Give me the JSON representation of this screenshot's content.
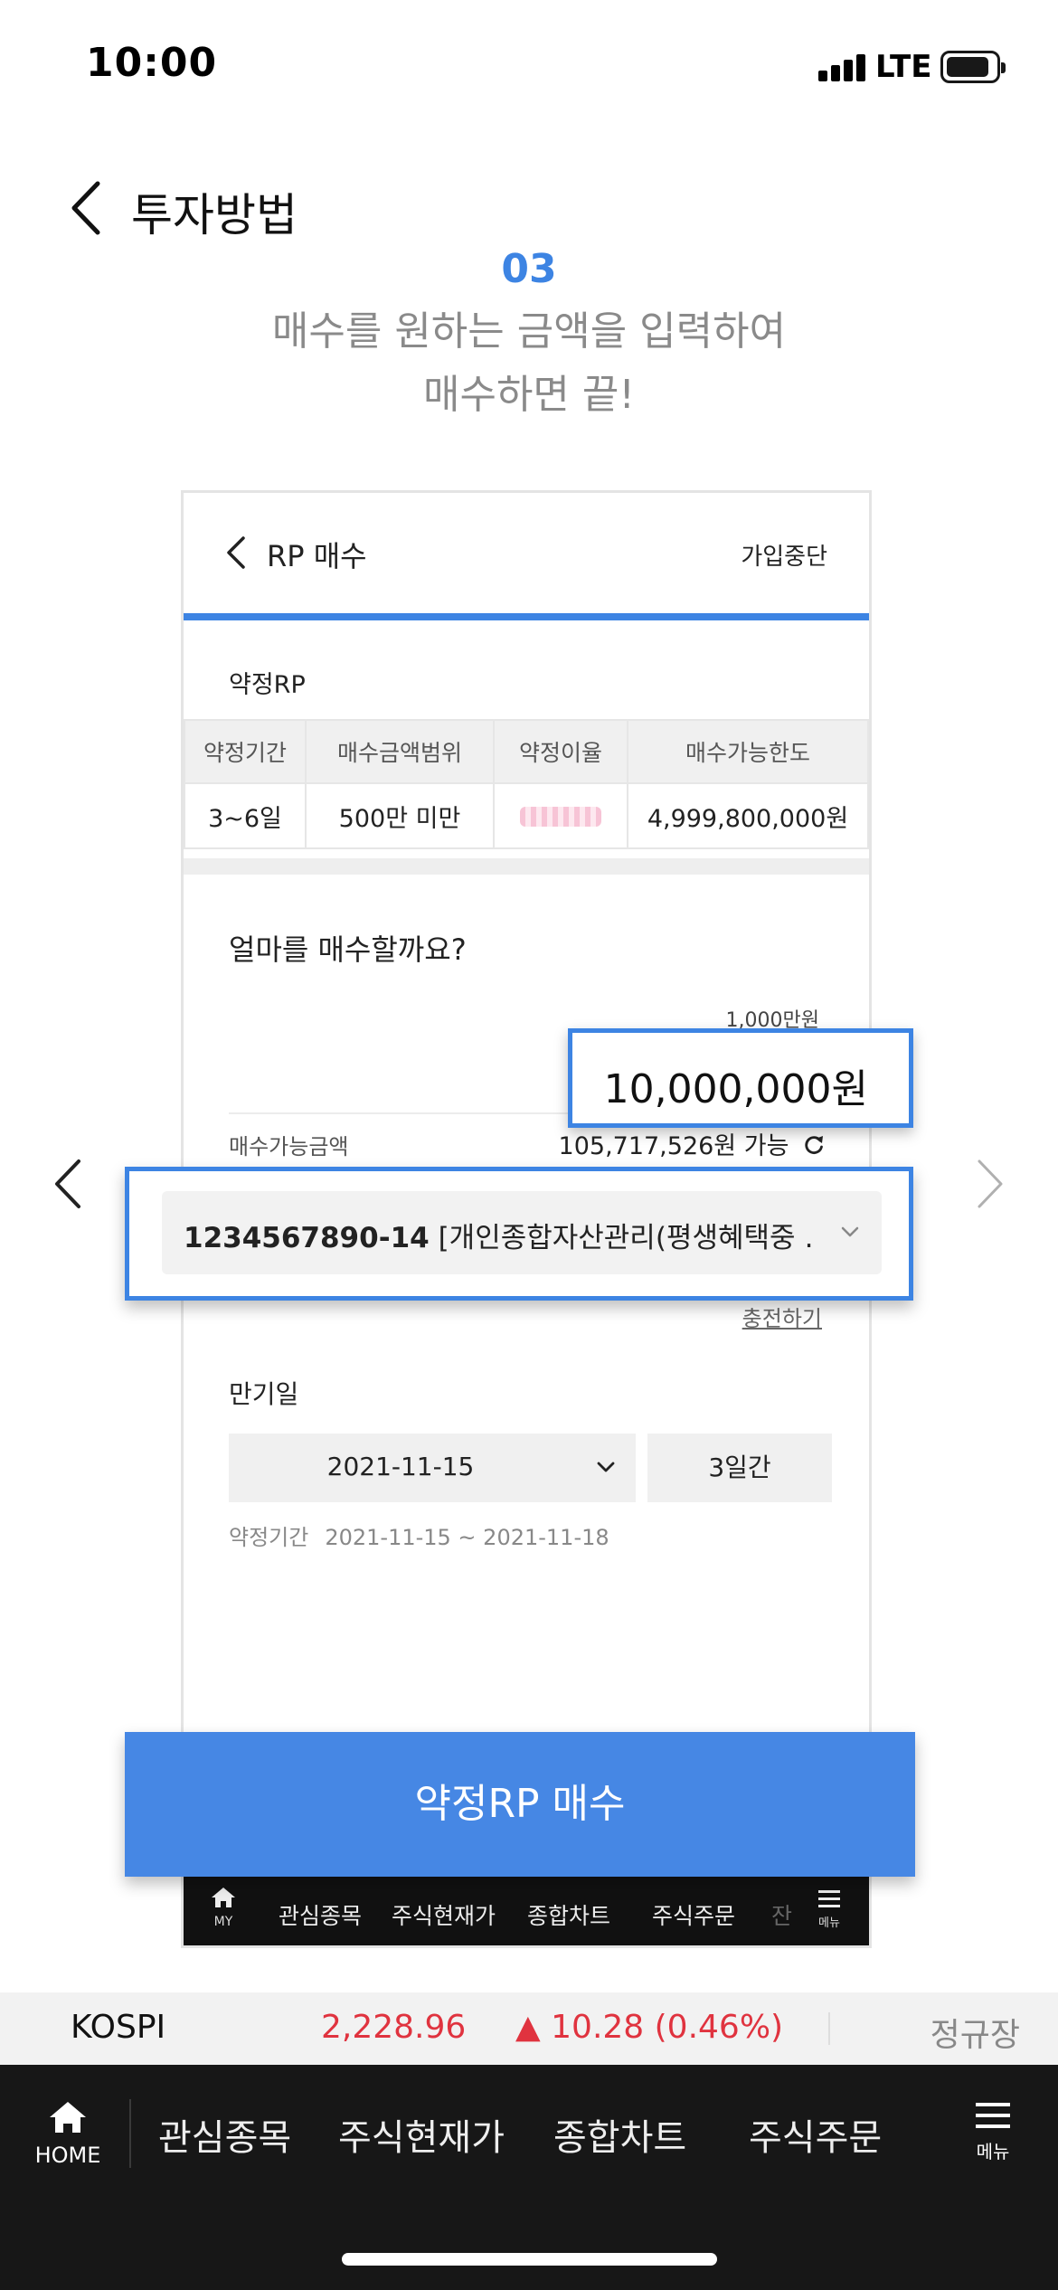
{
  "status_bar": {
    "time": "10:00",
    "network": "LTE"
  },
  "header": {
    "title": "투자방법"
  },
  "step": {
    "number": "03",
    "desc_line1": "매수를 원하는 금액을 입력하여",
    "desc_line2": "매수하면 끝!"
  },
  "phone": {
    "title": "RP 매수",
    "stop_label": "가입중단",
    "section_label": "약정RP",
    "table": {
      "headers": [
        "약정기간",
        "매수금액범위",
        "약정이율",
        "매수가능한도"
      ],
      "row": [
        "3~6일",
        "500만 미만",
        "",
        "4,999,800,000원"
      ]
    },
    "question": "얼마를 매수할까요?",
    "unit_hint": "1,000만원",
    "amount": "10,000,000원",
    "available_label": "매수가능금액",
    "available_value": "105,717,526원 가능",
    "account": {
      "number": "1234567890-14",
      "name": "[개인종합자산관리(평생혜택중 …"
    },
    "charge_link": "충전하기",
    "expiry_label": "만기일",
    "expiry_date": "2021-11-15",
    "expiry_days": "3일간",
    "period_label": "약정기간",
    "period_value": "2021-11-15 ~ 2021-11-18",
    "buy_button": "약정RP 매수",
    "mini_nav": {
      "home": "MY",
      "items": [
        "관심종목",
        "주식현재가",
        "종합차트",
        "주식주문",
        "잔"
      ],
      "menu": "메뉴"
    }
  },
  "ticker": {
    "name": "KOSPI",
    "price": "2,228.96",
    "change": "▲ 10.28 (0.46%)",
    "session": "정규장"
  },
  "bottom_nav": {
    "home": "HOME",
    "items": [
      "관심종목",
      "주식현재가",
      "종합차트",
      "주식주문"
    ],
    "menu": "메뉴"
  },
  "colors": {
    "accent": "#3d84e3",
    "button": "#4687e4",
    "up": "#e0333f"
  }
}
